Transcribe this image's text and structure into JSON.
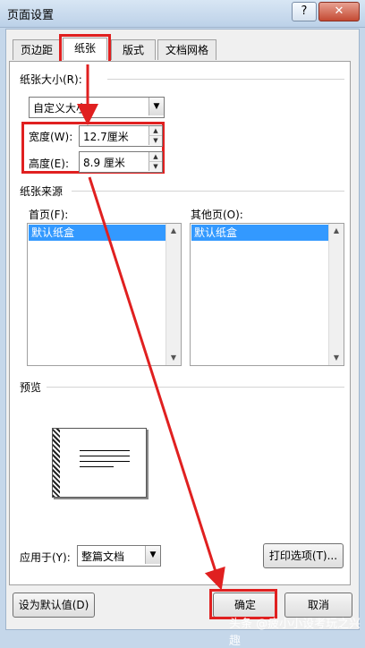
{
  "window": {
    "title": "页面设置",
    "help": "?",
    "close": "✕"
  },
  "tabs": [
    {
      "label": "页边距"
    },
    {
      "label": "纸张"
    },
    {
      "label": "版式"
    },
    {
      "label": "文档网格"
    }
  ],
  "paper_size": {
    "group_label": "纸张大小(R):",
    "selected": "自定义大小",
    "width_label": "宽度(W):",
    "width_value": "12.7厘米",
    "height_label": "高度(E):",
    "height_value": "8.9 厘米"
  },
  "paper_source": {
    "group_label": "纸张来源",
    "first_page_label": "首页(F):",
    "first_page_selected": "默认纸盒",
    "other_pages_label": "其他页(O):",
    "other_pages_selected": "默认纸盒"
  },
  "preview": {
    "label": "预览"
  },
  "apply": {
    "label": "应用于(Y):",
    "selected": "整篇文档",
    "print_options": "打印选项(T)..."
  },
  "footer": {
    "set_default": "设为默认值(D)",
    "ok": "确定",
    "cancel": "取消"
  },
  "watermark": "头条 @疲小小设考玩之兴趣",
  "colors": {
    "annotation": "#e02020",
    "selection": "#3399ff"
  }
}
